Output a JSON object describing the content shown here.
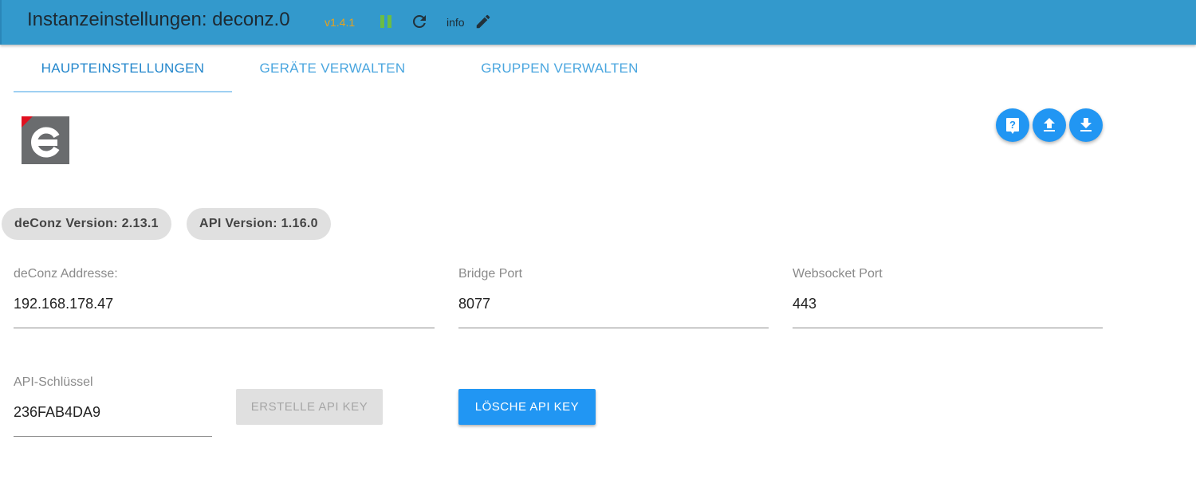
{
  "header": {
    "title": "Instanzeinstellungen: deconz.0",
    "version": "v1.4.1",
    "info_label": "info"
  },
  "tabs": [
    {
      "label": "HAUPTEINSTELLUNGEN",
      "active": true
    },
    {
      "label": "GERÄTE VERWALTEN",
      "active": false
    },
    {
      "label": "GRUPPEN VERWALTEN",
      "active": false
    }
  ],
  "logo_icon": "deconz-e-logo",
  "actions": [
    {
      "icon": "help-icon"
    },
    {
      "icon": "upload-icon"
    },
    {
      "icon": "download-icon"
    }
  ],
  "chips": {
    "deconz_version": "deConz Version: 2.13.1",
    "api_version": "API Version: 1.16.0"
  },
  "fields": {
    "address": {
      "label": "deConz Addresse:",
      "value": "192.168.178.47"
    },
    "bridge_port": {
      "label": "Bridge Port",
      "value": "8077"
    },
    "websocket_port": {
      "label": "Websocket Port",
      "value": "443"
    },
    "api_key": {
      "label": "API-Schlüssel",
      "value": "236FAB4DA9"
    }
  },
  "buttons": {
    "create_api_key": "ERSTELLE API KEY",
    "delete_api_key": "LÖSCHE API KEY"
  },
  "colors": {
    "header_bg": "#3399cc",
    "accent": "#2196f3",
    "version": "#e8a21b",
    "pause": "#6bbd45"
  }
}
